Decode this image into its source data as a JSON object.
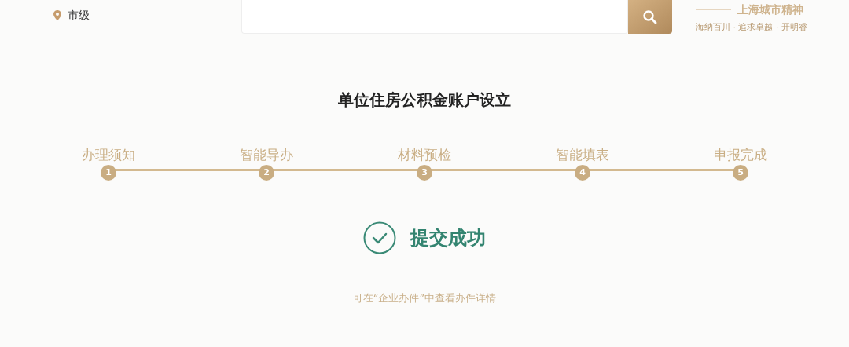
{
  "header": {
    "location": "市级",
    "slogan_title": "上海城市精神",
    "slogan_sub": "海纳百川 · 追求卓越 · 开明睿"
  },
  "title": "单位住房公积金账户设立",
  "steps": [
    {
      "label": "办理须知",
      "number": "1"
    },
    {
      "label": "智能导办",
      "number": "2"
    },
    {
      "label": "材料预检",
      "number": "3"
    },
    {
      "label": "智能填表",
      "number": "4"
    },
    {
      "label": "申报完成",
      "number": "5"
    }
  ],
  "result": {
    "message": "提交成功",
    "hint": "可在“企业办件”中查看办件详情"
  }
}
